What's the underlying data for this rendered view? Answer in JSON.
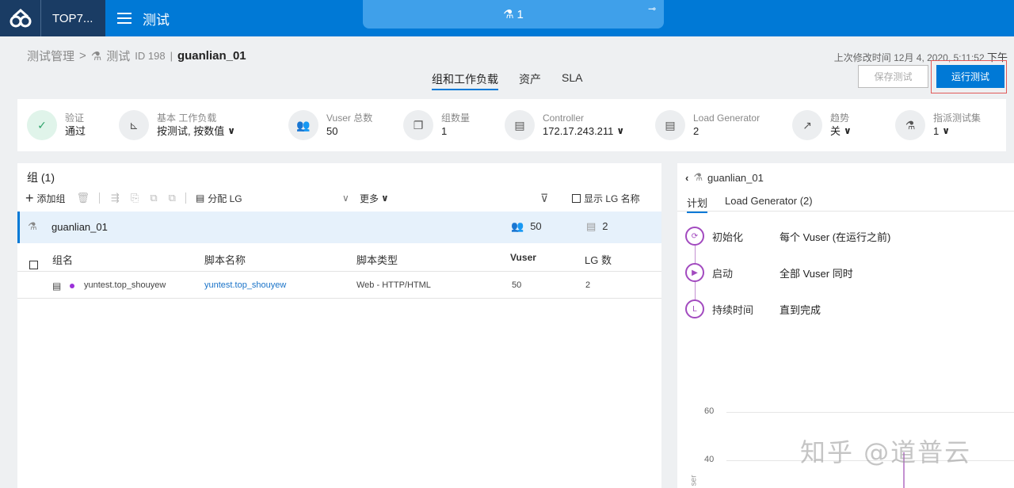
{
  "header": {
    "app_short": "TOP7...",
    "page": "测试",
    "run_tab_label": "1"
  },
  "breadcrumb": {
    "root": "测试管理",
    "sep": ">",
    "test_label": "测试",
    "test_id": "ID 198",
    "divider": "|",
    "test_name": "guanlian_01"
  },
  "last_modified": {
    "label": "上次修改时间",
    "value": "12月 4, 2020, 5:11:52",
    "suffix": "下午"
  },
  "tabs": [
    "组和工作负载",
    "资产",
    "SLA"
  ],
  "buttons": {
    "save": "保存测试",
    "run": "运行测试"
  },
  "summary": [
    {
      "label": "验证",
      "value": "通过",
      "icon": "check-circle-icon"
    },
    {
      "label": "基本 工作负载",
      "value": "按测试, 按数值",
      "chevron": true,
      "icon": "chart-axis-icon"
    },
    {
      "label": "Vuser 总数",
      "value": "50",
      "icon": "users-icon"
    },
    {
      "label": "组数量",
      "value": "1",
      "icon": "group-icon"
    },
    {
      "label": "Controller",
      "value": "172.17.243.211",
      "chevron": true,
      "icon": "server-icon"
    },
    {
      "label": "Load Generator",
      "value": "2",
      "icon": "server-icon"
    },
    {
      "label": "趋势",
      "value": "关",
      "chevron": true,
      "icon": "trend-icon"
    },
    {
      "label": "指派测试集",
      "value": "1",
      "chevron": true,
      "icon": "flask-icon"
    }
  ],
  "groups_panel": {
    "title": "组 (1)",
    "toolbar": {
      "add": "添加组",
      "assign_lg": "分配 LG",
      "more": "更多",
      "show_lg_names": "显示 LG 名称"
    },
    "group_row": {
      "name": "guanlian_01",
      "vusers": "50",
      "lgs": "2"
    },
    "columns": [
      "组名",
      "脚本名称",
      "脚本类型",
      "Vuser",
      "LG 数"
    ],
    "rows": [
      {
        "group": "yuntest.top_shouyew",
        "script": "yuntest.top_shouyew",
        "type": "Web - HTTP/HTML",
        "vusers": "50",
        "lgs": "2"
      }
    ]
  },
  "detail_panel": {
    "title": "guanlian_01",
    "tabs": [
      "计划",
      "Load Generator (2)"
    ],
    "schedule": [
      {
        "label": "初始化",
        "value": "每个 Vuser (在运行之前)",
        "icon": "refresh-icon"
      },
      {
        "label": "启动",
        "value": "全部 Vuser 同时",
        "icon": "play-icon"
      },
      {
        "label": "持续时间",
        "value": "直到完成",
        "icon": "clock-icon"
      }
    ],
    "y_ticks": [
      "60",
      "40"
    ],
    "y_axis_title": "ser"
  },
  "watermark": "知乎 @道普云"
}
